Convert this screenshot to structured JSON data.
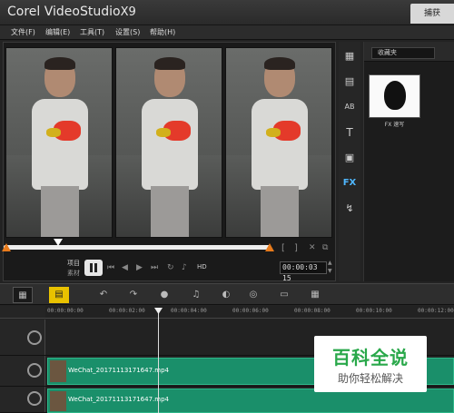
{
  "app": {
    "brand": "Corel",
    "product": "VideoStudio",
    "version": "X9",
    "right_tab": "捕获"
  },
  "menu": [
    {
      "label": "文件(F)"
    },
    {
      "label": "编辑(E)"
    },
    {
      "label": "工具(T)"
    },
    {
      "label": "设置(S)"
    },
    {
      "label": "帮助(H)"
    }
  ],
  "player": {
    "mode_project": "项目",
    "mode_clip": "素材",
    "timecode": "00:00:03",
    "timecode_field": "15",
    "hd": "HD",
    "scrub_position_percent": 21
  },
  "library": {
    "folder": "收藏夹",
    "items": [
      {
        "label": "FX 速写"
      }
    ]
  },
  "timeline": {
    "ruler_ticks": [
      "00:00:00:00",
      "00:00:02:00",
      "00:00:04:00",
      "00:00:06:00",
      "00:00:08:00",
      "00:00:10:00",
      "00:00:12:00"
    ],
    "clips": [
      {
        "label": "WeChat_20171113171647.mp4"
      },
      {
        "label": "WeChat_20171113171647.mp4"
      }
    ]
  },
  "watermark": {
    "title": "百科全说",
    "subtitle": "助你轻松解决"
  },
  "colors": {
    "accent": "#e87b1c",
    "clip_green": "#1a8f6a",
    "fx_blue": "#4fb7ff",
    "watermark_green": "#29a84a"
  }
}
